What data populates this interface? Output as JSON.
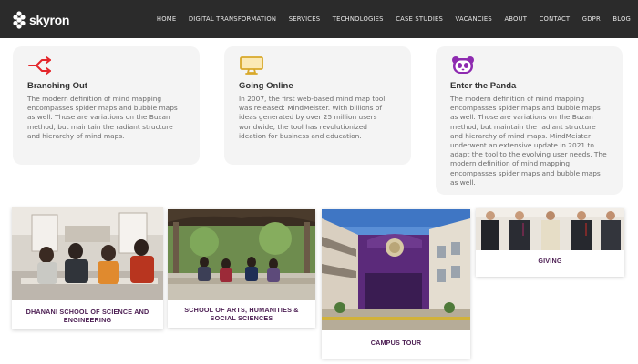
{
  "brand": {
    "name": "skyron",
    "logo_icon": "skyron-logo-icon"
  },
  "nav": {
    "items": [
      "HOME",
      "DIGITAL TRANSFORMATION",
      "SERVICES",
      "TECHNOLOGIES",
      "CASE STUDIES",
      "VACANCIES",
      "ABOUT",
      "CONTACT",
      "GDPR",
      "BLOG"
    ]
  },
  "cards": [
    {
      "icon": "split-arrows-icon",
      "icon_color": "#e4262b",
      "title": "Branching Out",
      "text": "The modern definition of mind mapping encompasses spider maps and bubble maps as well. Those are variations on the Buzan method, but maintain the radiant structure and hierarchy of mind maps."
    },
    {
      "icon": "monitor-icon",
      "icon_color": "#d8a82a",
      "title": "Going Online",
      "text": "In 2007, the first web-based mind map tool was released: MindMeister. With billions of ideas generated by over 25 million users worldwide, the tool has revolutionized ideation for business and education."
    },
    {
      "icon": "panda-icon",
      "icon_color": "#8e2bb0",
      "title": "Enter the Panda",
      "text": "The modern definition of mind mapping encompasses spider maps and bubble maps as well. Those are variations on the Buzan method, but maintain the radiant structure and hierarchy of mind maps. MindMeister underwent an extensive update in 2021 to adapt the tool to the evolving user needs. The modern definition of mind mapping encompasses spider maps and bubble maps as well."
    }
  ],
  "tiles": [
    {
      "label": "DHANANI SCHOOL OF SCIENCE AND ENGINEERING"
    },
    {
      "label": "SCHOOL OF ARTS, HUMANITIES & SOCIAL SCIENCES"
    },
    {
      "label": "CAMPUS TOUR"
    },
    {
      "label": "GIVING"
    }
  ],
  "colors": {
    "header_bg": "#2b2b2b",
    "card_bg": "#f4f4f4",
    "tile_label": "#4b1d52"
  }
}
